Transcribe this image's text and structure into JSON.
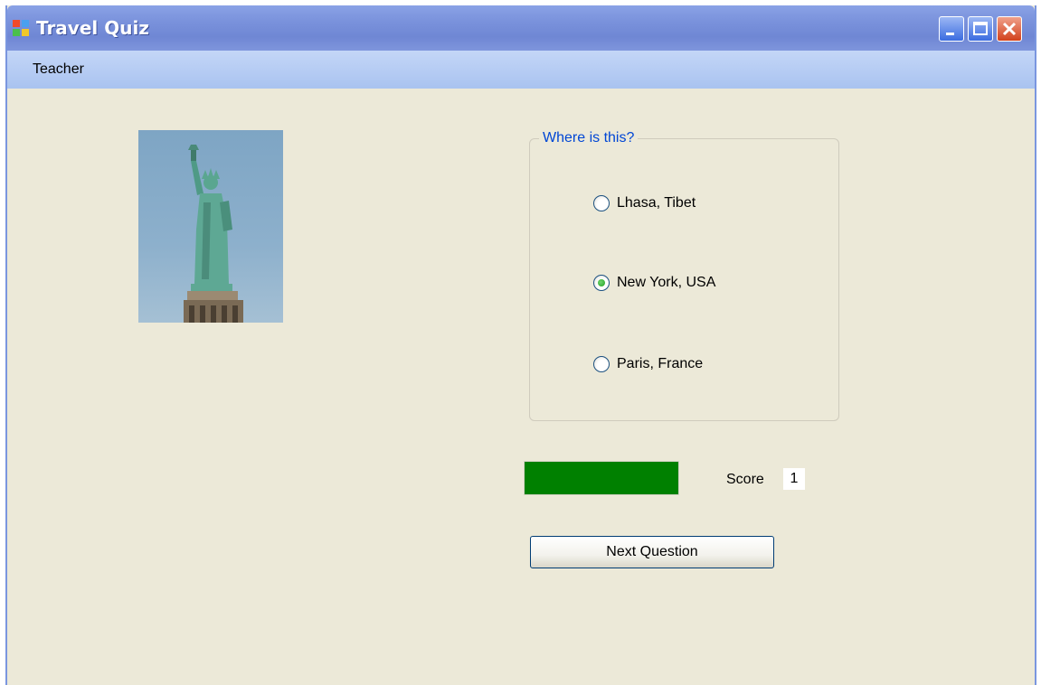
{
  "window": {
    "title": "Travel Quiz",
    "controls": [
      "minimize-icon",
      "maximize-icon",
      "close-icon"
    ]
  },
  "menu": {
    "items": [
      {
        "label": "Teacher"
      }
    ]
  },
  "question": {
    "prompt": "Where is this?",
    "options": [
      {
        "label": "Lhasa, Tibet",
        "selected": false
      },
      {
        "label": "New York, USA",
        "selected": true
      },
      {
        "label": "Paris, France",
        "selected": false
      }
    ]
  },
  "progress": {
    "fraction": 1.0,
    "color": "#008000"
  },
  "score": {
    "label": "Score",
    "value": "1"
  },
  "next_button": {
    "label": "Next Question"
  },
  "colors": {
    "titlebar": "#7a92dc",
    "menubar": "#a9c3f0",
    "background": "#ece9d8",
    "legend": "#0046d5"
  }
}
